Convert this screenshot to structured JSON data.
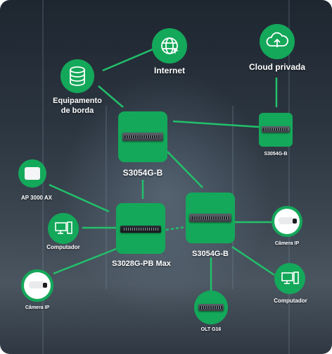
{
  "nodes": {
    "internet": "Internet",
    "cloud": "Cloud privada",
    "edge": "Equipamento\nde borda",
    "s3054g_top": "S3054G-B",
    "s3054g_small": "S3054G-B",
    "s3054g_mid": "S3054G-B",
    "s3028g": "S3028G-PB Max",
    "ap": "AP 3000 AX",
    "computer_left": "Computador",
    "camera_left": "Câmera IP",
    "camera_right": "Câmera IP",
    "computer_right": "Computador",
    "olt": "OLT G16"
  },
  "colors": {
    "accent": "#14a85a",
    "link": "#22c06a",
    "text": "#ffffff"
  },
  "icons": [
    "globe-icon",
    "cloud-upload-icon",
    "database-icon",
    "switch-icon",
    "access-point-icon",
    "computer-icon",
    "camera-icon",
    "olt-icon"
  ]
}
